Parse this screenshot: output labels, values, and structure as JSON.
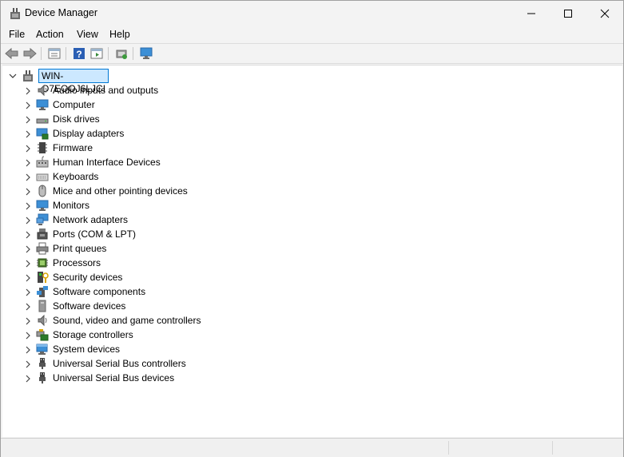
{
  "window": {
    "title": "Device Manager"
  },
  "menu": [
    "File",
    "Action",
    "View",
    "Help"
  ],
  "tree": {
    "root": "WIN-O7EOOJ6LJCI",
    "items": [
      {
        "label": "Audio inputs and outputs",
        "icon": "speaker-icon"
      },
      {
        "label": "Computer",
        "icon": "computer-icon"
      },
      {
        "label": "Disk drives",
        "icon": "disk-drive-icon"
      },
      {
        "label": "Display adapters",
        "icon": "display-adapter-icon"
      },
      {
        "label": "Firmware",
        "icon": "firmware-chip-icon"
      },
      {
        "label": "Human Interface Devices",
        "icon": "hid-icon"
      },
      {
        "label": "Keyboards",
        "icon": "keyboard-icon"
      },
      {
        "label": "Mice and other pointing devices",
        "icon": "mouse-icon"
      },
      {
        "label": "Monitors",
        "icon": "monitor-icon"
      },
      {
        "label": "Network adapters",
        "icon": "network-adapter-icon"
      },
      {
        "label": "Ports (COM & LPT)",
        "icon": "port-icon"
      },
      {
        "label": "Print queues",
        "icon": "printer-icon"
      },
      {
        "label": "Processors",
        "icon": "processor-icon"
      },
      {
        "label": "Security devices",
        "icon": "security-device-icon"
      },
      {
        "label": "Software components",
        "icon": "software-component-icon"
      },
      {
        "label": "Software devices",
        "icon": "software-device-icon"
      },
      {
        "label": "Sound, video and game controllers",
        "icon": "sound-controller-icon"
      },
      {
        "label": "Storage controllers",
        "icon": "storage-controller-icon"
      },
      {
        "label": "System devices",
        "icon": "system-device-icon"
      },
      {
        "label": "Universal Serial Bus controllers",
        "icon": "usb-icon"
      },
      {
        "label": "Universal Serial Bus devices",
        "icon": "usb-icon"
      }
    ]
  },
  "toolbar": [
    "back-icon",
    "forward-icon",
    "properties-icon",
    "help-icon",
    "view-icon",
    "scan-hardware-icon",
    "computer-icon"
  ]
}
